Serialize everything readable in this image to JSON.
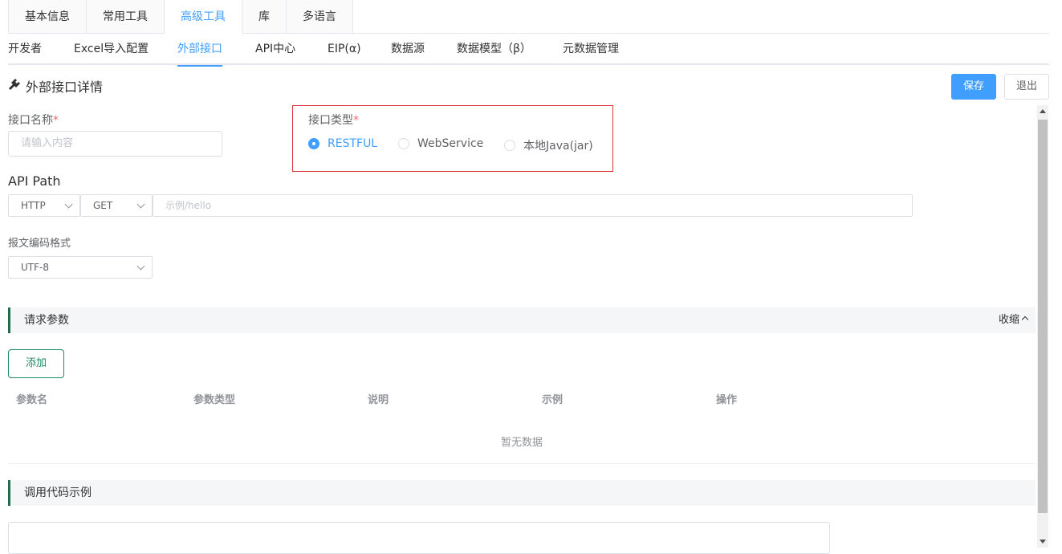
{
  "top_tabs": [
    "基本信息",
    "常用工具",
    "高级工具",
    "库",
    "多语言"
  ],
  "top_tabs_active": "高级工具",
  "sub_tabs": [
    "开发者",
    "Excel导入配置",
    "外部接口",
    "API中心",
    "EIP(α)",
    "数据源",
    "数据模型（β）",
    "元数据管理"
  ],
  "sub_tabs_active": "外部接口",
  "page": {
    "title": "外部接口详情",
    "icon": "plug-icon"
  },
  "actions": {
    "save": "保存",
    "exit": "退出"
  },
  "form": {
    "name_label": "接口名称",
    "name_placeholder": "请输入内容",
    "type_label": "接口类型",
    "required_mark": "*",
    "type_options": [
      "RESTFUL",
      "WebService",
      "本地Java(jar)"
    ],
    "type_selected": "RESTFUL",
    "api_path_label": "API Path",
    "protocol": "HTTP",
    "method": "GET",
    "path_placeholder": "示例/hello",
    "encoding_label": "报文编码格式",
    "encoding": "UTF-8"
  },
  "request_params": {
    "title": "请求参数",
    "collapse": "收缩",
    "add_button": "添加",
    "columns": [
      "参数名",
      "参数类型",
      "说明",
      "示例",
      "操作"
    ],
    "empty_text": "暂无数据"
  },
  "code_example": {
    "title": "调用代码示例"
  },
  "colors": {
    "primary": "#409eff",
    "required": "#f56c6c",
    "highlight_border": "#d9363e",
    "section_accent": "#1f6e4f"
  }
}
